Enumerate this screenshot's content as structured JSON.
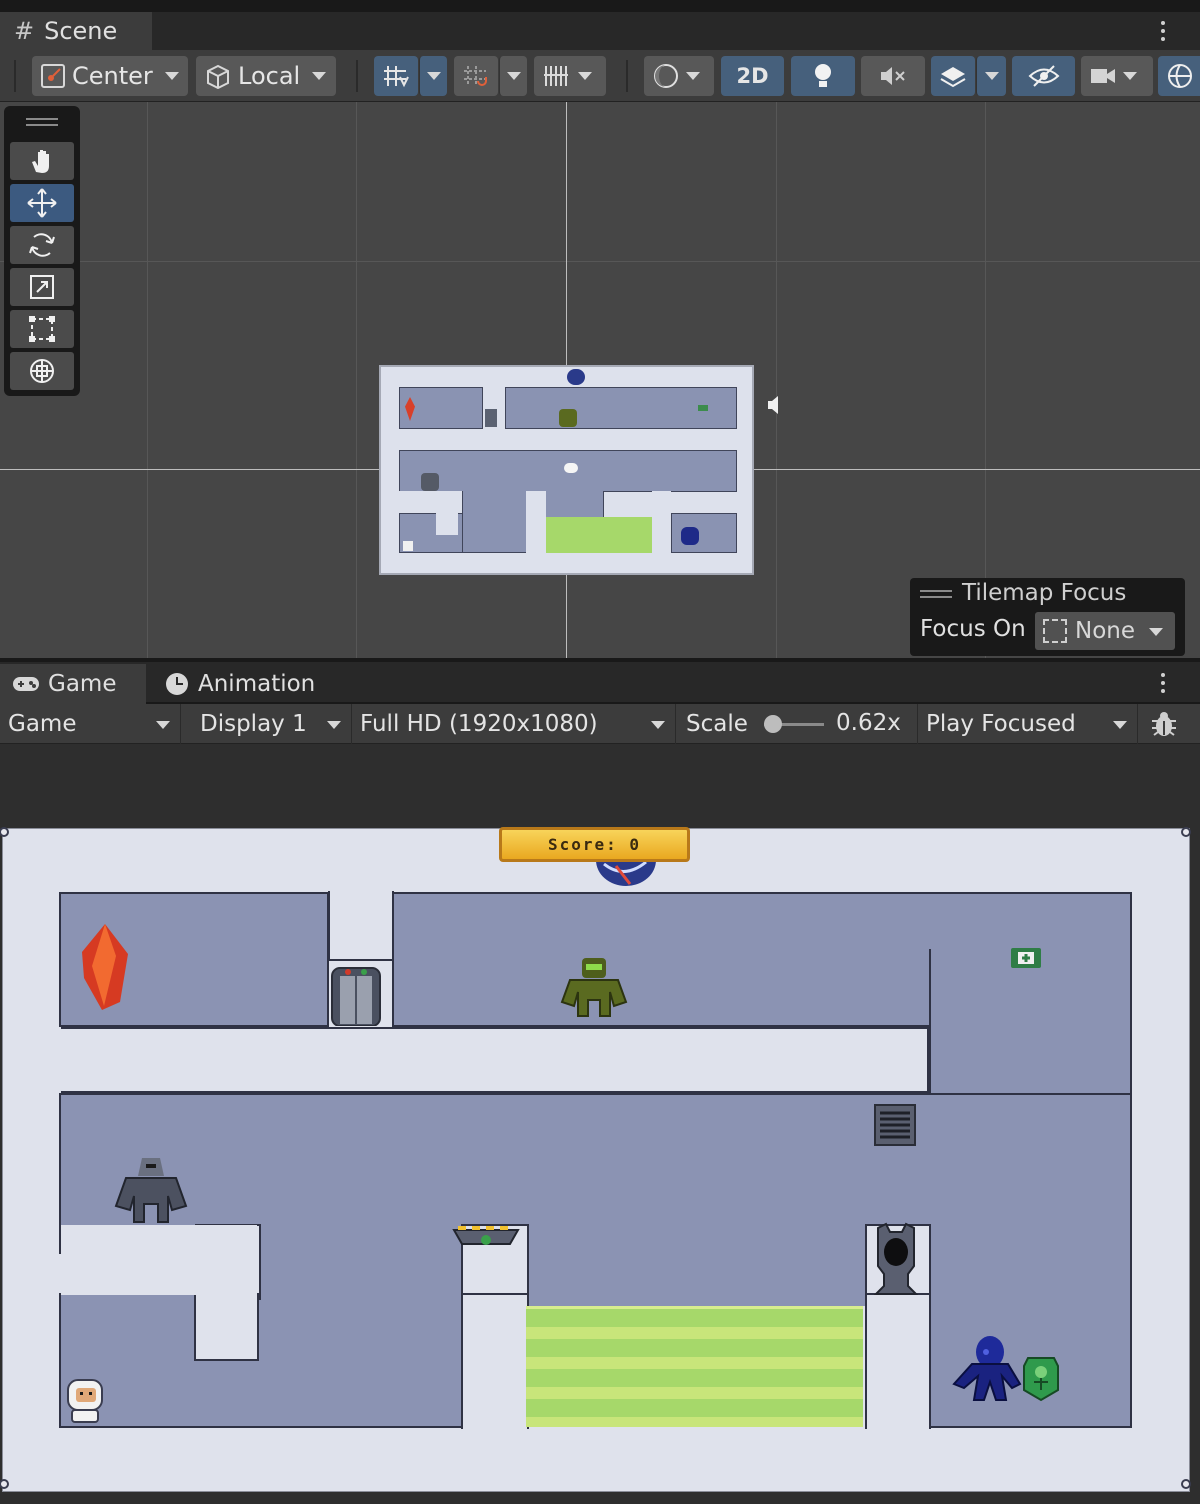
{
  "scene": {
    "tab_label": "Scene",
    "tab_icon": "grid-hash-icon",
    "pivot_label": "Center",
    "space_label": "Local",
    "mode_2d": "2D"
  },
  "tilemap_focus": {
    "title": "Tilemap Focus",
    "focus_on_label": "Focus On",
    "focus_value": "None"
  },
  "game_panel": {
    "tab_game": "Game",
    "tab_animation": "Animation",
    "view_select": "Game",
    "display_select": "Display 1",
    "resolution_select": "Full HD (1920x1080)",
    "scale_label": "Scale",
    "scale_value": "0.62x",
    "play_mode": "Play Focused"
  },
  "hud": {
    "score_text": "Score: 0"
  },
  "colors": {
    "accent": "#46607c",
    "level_bg": "#dfe2ec",
    "room_fill": "#8b93b3",
    "acid": "#a6d86a",
    "score_gold": "#f0c040"
  }
}
